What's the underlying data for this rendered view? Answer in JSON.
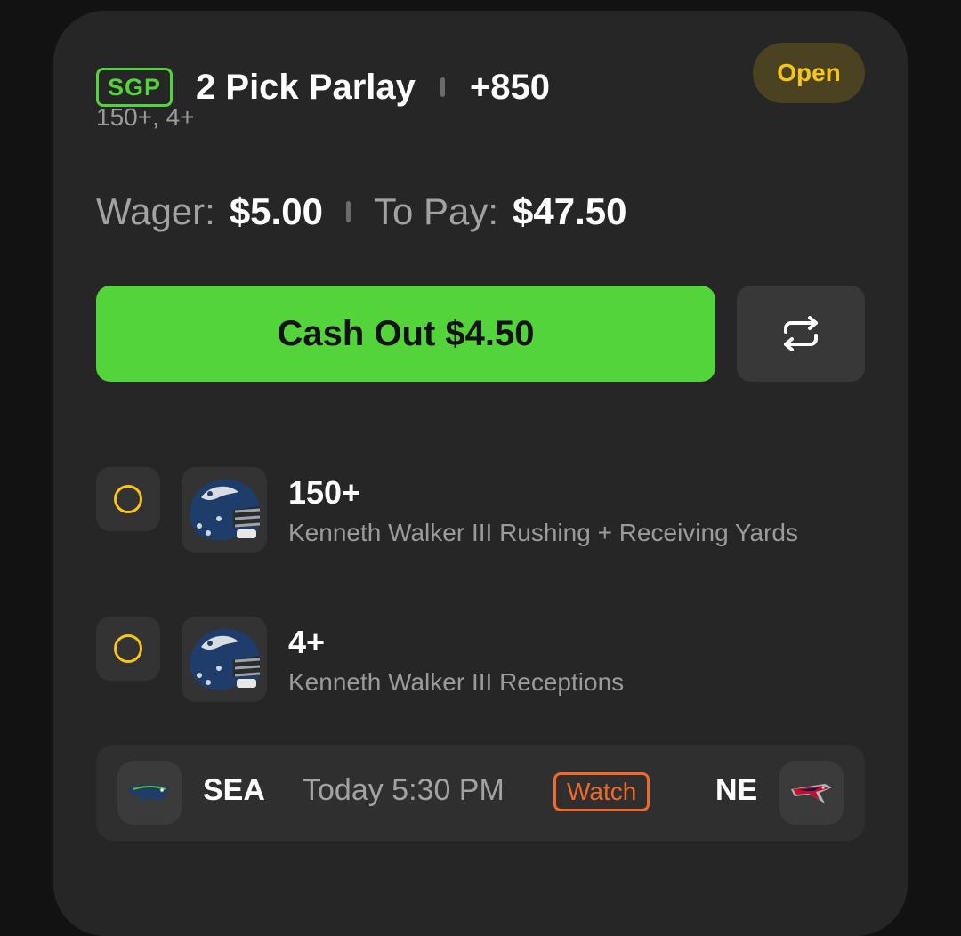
{
  "bet": {
    "badge": "SGP",
    "title": "2 Pick Parlay",
    "odds": "+850",
    "status": "Open",
    "subtitle": "150+, 4+",
    "wager_label": "Wager:",
    "wager_value": "$5.00",
    "to_pay_label": "To Pay:",
    "to_pay_value": "$47.50",
    "cashout_label": "Cash Out $4.50",
    "swap_icon": "swap-arrows-icon"
  },
  "legs": [
    {
      "line": "150+",
      "description": "Kenneth Walker III Rushing + Receiving Yards",
      "status_icon": "pending-circle-icon",
      "team_icon": "seahawks-helmet-icon"
    },
    {
      "line": "4+",
      "description": "Kenneth Walker III Receptions",
      "status_icon": "pending-circle-icon",
      "team_icon": "seahawks-helmet-icon"
    }
  ],
  "game": {
    "away_team": "SEA",
    "away_logo": "seahawks-logo-icon",
    "time": "Today 5:30 PM",
    "watch_label": "Watch",
    "home_team": "NE",
    "home_logo": "patriots-logo-icon"
  },
  "colors": {
    "accent_green": "#52d43a",
    "pending_yellow": "#f5c518",
    "watch_orange": "#f0692b",
    "card_bg": "#262626",
    "page_bg": "#121212"
  }
}
